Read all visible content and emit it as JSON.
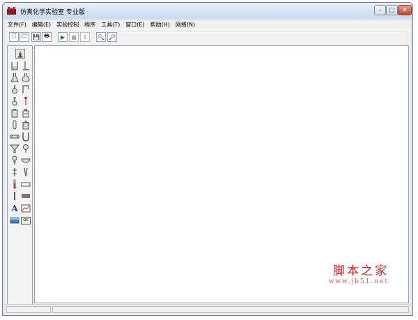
{
  "window": {
    "title": "仿真化学实验室 专业版"
  },
  "controls": {
    "minimize": "–",
    "maximize": "□",
    "close": "✕"
  },
  "menu": [
    "文件(F)",
    "编辑(E)",
    "实验控制",
    "程序",
    "工具(T)",
    "窗口(E)",
    "帮助(H)",
    "网络(N)"
  ],
  "toolbar": [
    {
      "id": "new",
      "icon": "new-file-icon",
      "glyph": "🗋"
    },
    {
      "id": "open",
      "icon": "open-folder-icon",
      "glyph": "🗁"
    },
    {
      "id": "save",
      "icon": "save-icon",
      "glyph": "💾"
    },
    {
      "id": "print",
      "icon": "printer-icon",
      "glyph": "🖶"
    },
    {
      "id": "run",
      "icon": "play-icon",
      "glyph": "▶"
    },
    {
      "id": "stop",
      "icon": "stop-icon",
      "glyph": "■"
    },
    {
      "id": "pause",
      "icon": "pause-icon",
      "glyph": "Ⅱ"
    },
    {
      "id": "zoom-in",
      "icon": "zoom-in-icon",
      "glyph": "🔍"
    },
    {
      "id": "zoom-out",
      "icon": "zoom-out-icon",
      "glyph": "🔎"
    }
  ],
  "palette": {
    "text_tool_label": "A",
    "ok_label": "OK",
    "tools": [
      "burner-icon",
      "beaker-icon",
      "stand-icon",
      "conical-flask-icon",
      "flask-icon",
      "round-flask-icon",
      "tube-holder-icon",
      "flask-stopper-icon",
      "dropper-icon",
      "bottle-icon",
      "reagent-bottle-icon",
      "test-tube-icon",
      "gas-bottle-icon",
      "condenser-icon",
      "u-tube-icon",
      "funnel-icon",
      "separatory-funnel-icon",
      "dropping-funnel-icon",
      "dish-icon",
      "clamp-icon",
      "tweezers-icon",
      "thermometer-icon",
      "glass-slide-icon",
      "rod-icon",
      "block-icon",
      "text-icon",
      "chart-icon",
      "liquid-icon",
      "ok-button-icon"
    ]
  },
  "watermark": {
    "main": "脚本之家",
    "url": "www.jb51.net"
  }
}
